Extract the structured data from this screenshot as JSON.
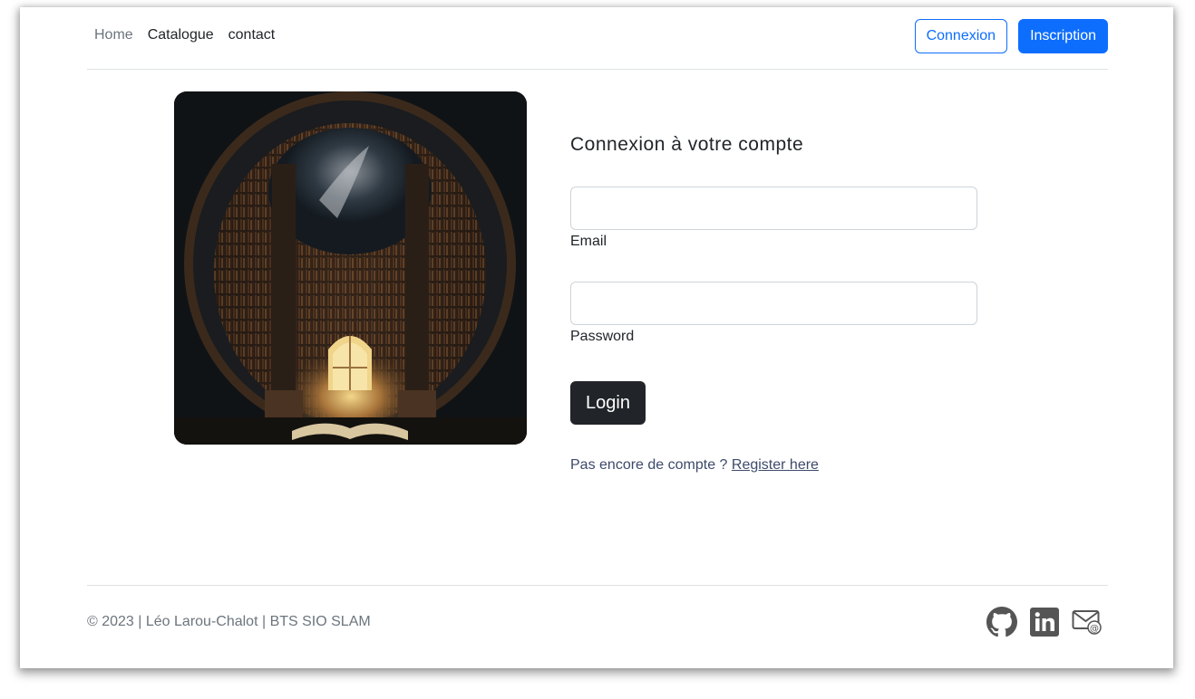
{
  "nav": {
    "items": [
      "Home",
      "Catalogue",
      "contact"
    ]
  },
  "auth": {
    "login_label": "Connexion",
    "signup_label": "Inscription"
  },
  "form": {
    "title": "Connexion à votre compte",
    "email_label": "Email",
    "password_label": "Password",
    "email_value": "",
    "password_value": "",
    "submit_label": "Login",
    "register_prompt": "Pas encore de compte ?",
    "register_link": "Register here"
  },
  "footer": {
    "copyright": "© 2023 | Léo Larou-Chalot | BTS SIO SLAM",
    "icons": [
      "github-icon",
      "linkedin-icon",
      "mail-icon"
    ]
  },
  "colors": {
    "primary": "#0d6efd",
    "dark_button": "#212529",
    "muted": "#6c757d"
  }
}
